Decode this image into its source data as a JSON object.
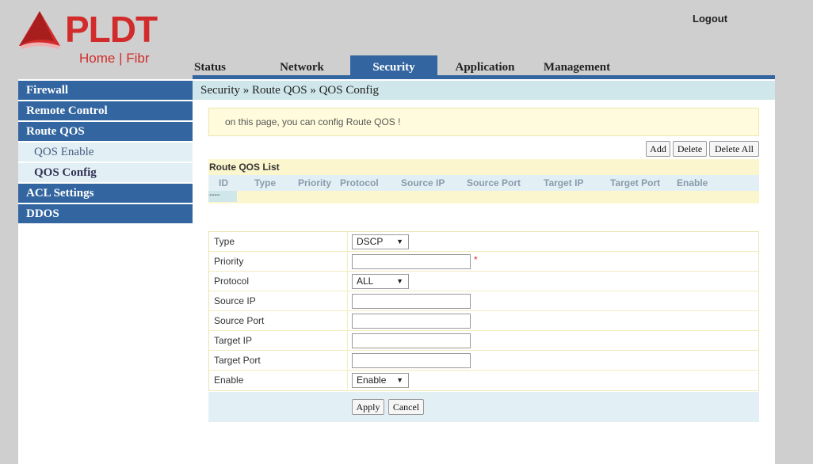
{
  "brand": {
    "name": "PLDT",
    "sub": "Home | Fibr"
  },
  "header": {
    "logout": "Logout"
  },
  "tabs": [
    "Status",
    "Network",
    "Security",
    "Application",
    "Management"
  ],
  "sidebar": {
    "items": [
      {
        "label": "Firewall"
      },
      {
        "label": "Remote Control"
      },
      {
        "label": "Route QOS"
      },
      {
        "label": "QOS Enable"
      },
      {
        "label": "QOS Config"
      },
      {
        "label": "ACL Settings"
      },
      {
        "label": "DDOS"
      }
    ]
  },
  "breadcrumb": "Security » Route QOS » QOS Config",
  "notice": "on this page, you can config Route QOS !",
  "list_buttons": {
    "add": "Add",
    "delete": "Delete",
    "delete_all": "Delete All"
  },
  "list": {
    "title": "Route QOS List",
    "columns": [
      "ID",
      "Type",
      "Priority",
      "Protocol",
      "Source IP",
      "Source Port",
      "Target IP",
      "Target Port",
      "Enable"
    ],
    "row_placeholder": "----"
  },
  "form": {
    "type": {
      "label": "Type",
      "value": "DSCP"
    },
    "priority": {
      "label": "Priority",
      "value": "",
      "required_mark": "*"
    },
    "protocol": {
      "label": "Protocol",
      "value": "ALL"
    },
    "source_ip": {
      "label": "Source IP",
      "value": ""
    },
    "source_port": {
      "label": "Source Port",
      "value": ""
    },
    "target_ip": {
      "label": "Target IP",
      "value": ""
    },
    "target_port": {
      "label": "Target Port",
      "value": ""
    },
    "enable": {
      "label": "Enable",
      "value": "Enable"
    }
  },
  "actions": {
    "apply": "Apply",
    "cancel": "Cancel"
  },
  "colors": {
    "brand_red": "#d22b2b",
    "nav_blue": "#3366a0",
    "light_blue": "#e2f0f6",
    "pale_yellow": "#fcf6cf"
  }
}
